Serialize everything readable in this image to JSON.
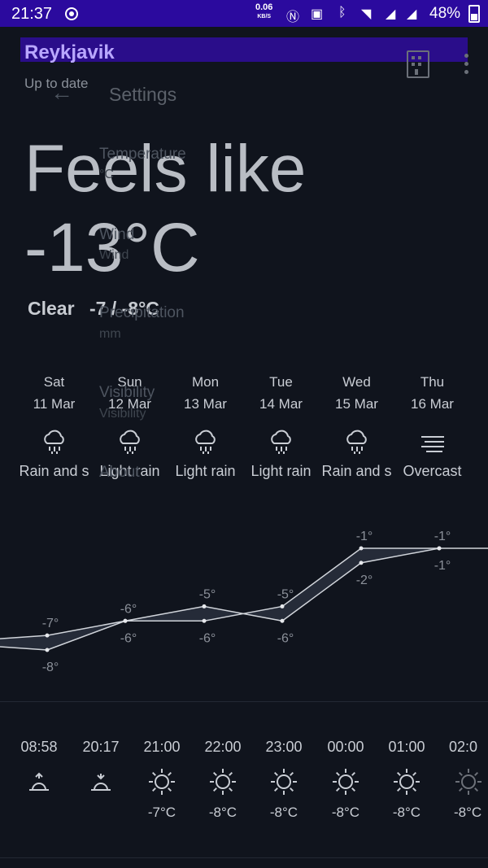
{
  "status_bar": {
    "time": "21:37",
    "net_speed": "0.06",
    "net_unit": "KB/S",
    "battery": "48%"
  },
  "header": {
    "city": "Reykjavik",
    "update_status": "Up to date"
  },
  "settings_overlay": {
    "title": "Settings",
    "items": [
      {
        "label": "Temperature",
        "sub": "°C"
      },
      {
        "label": "Wind",
        "sub": "Wind"
      },
      {
        "label": "Precipitation",
        "sub": "mm"
      },
      {
        "label": "Visibility",
        "sub": "Visibility"
      },
      {
        "label": "About",
        "sub": ""
      }
    ]
  },
  "current": {
    "feels_like_label": "Feels like",
    "feels_like_value": "-13°C",
    "condition": "Clear",
    "range": "-7 / -8°C"
  },
  "days": [
    {
      "name": "Sat",
      "date": "11 Mar",
      "condition": "Rain and s",
      "icon": "rain-cloud-icon"
    },
    {
      "name": "Sun",
      "date": "12 Mar",
      "condition": "Light rain",
      "icon": "rain-cloud-icon"
    },
    {
      "name": "Mon",
      "date": "13 Mar",
      "condition": "Light rain",
      "icon": "rain-cloud-icon"
    },
    {
      "name": "Tue",
      "date": "14 Mar",
      "condition": "Light rain",
      "icon": "rain-cloud-icon"
    },
    {
      "name": "Wed",
      "date": "15 Mar",
      "condition": "Rain and s",
      "icon": "rain-cloud-icon"
    },
    {
      "name": "Thu",
      "date": "16 Mar",
      "condition": "Overcast",
      "icon": "fog-icon"
    }
  ],
  "chart_data": {
    "type": "line",
    "categories": [
      "Sat",
      "Sun",
      "Mon",
      "Tue",
      "Wed",
      "Thu"
    ],
    "series": [
      {
        "values": [
          -7,
          -6,
          -5,
          -6,
          -2,
          -1
        ]
      },
      {
        "values": [
          -8,
          -6,
          -6,
          -5,
          -1,
          -1
        ]
      }
    ],
    "labels_top": [
      "-7°",
      "-6°",
      "-5°",
      "-6°",
      "-2°",
      "-1°"
    ],
    "labels_bottom": [
      "-8°",
      "-6°",
      "-6°",
      "-5°",
      "-1°",
      "-1°"
    ],
    "ylim": [
      -9,
      0
    ]
  },
  "hourly": [
    {
      "time": "08:58",
      "icon": "sunrise-icon",
      "temp": ""
    },
    {
      "time": "20:17",
      "icon": "sunset-icon",
      "temp": ""
    },
    {
      "time": "21:00",
      "icon": "sun-icon",
      "temp": "-7°C"
    },
    {
      "time": "22:00",
      "icon": "sun-icon",
      "temp": "-8°C"
    },
    {
      "time": "23:00",
      "icon": "sun-icon",
      "temp": "-8°C"
    },
    {
      "time": "00:00",
      "icon": "sun-icon",
      "temp": "-8°C"
    },
    {
      "time": "01:00",
      "icon": "sun-icon",
      "temp": "-8°C"
    },
    {
      "time": "02:0",
      "icon": "sun-icon",
      "temp": "-8°C"
    }
  ]
}
